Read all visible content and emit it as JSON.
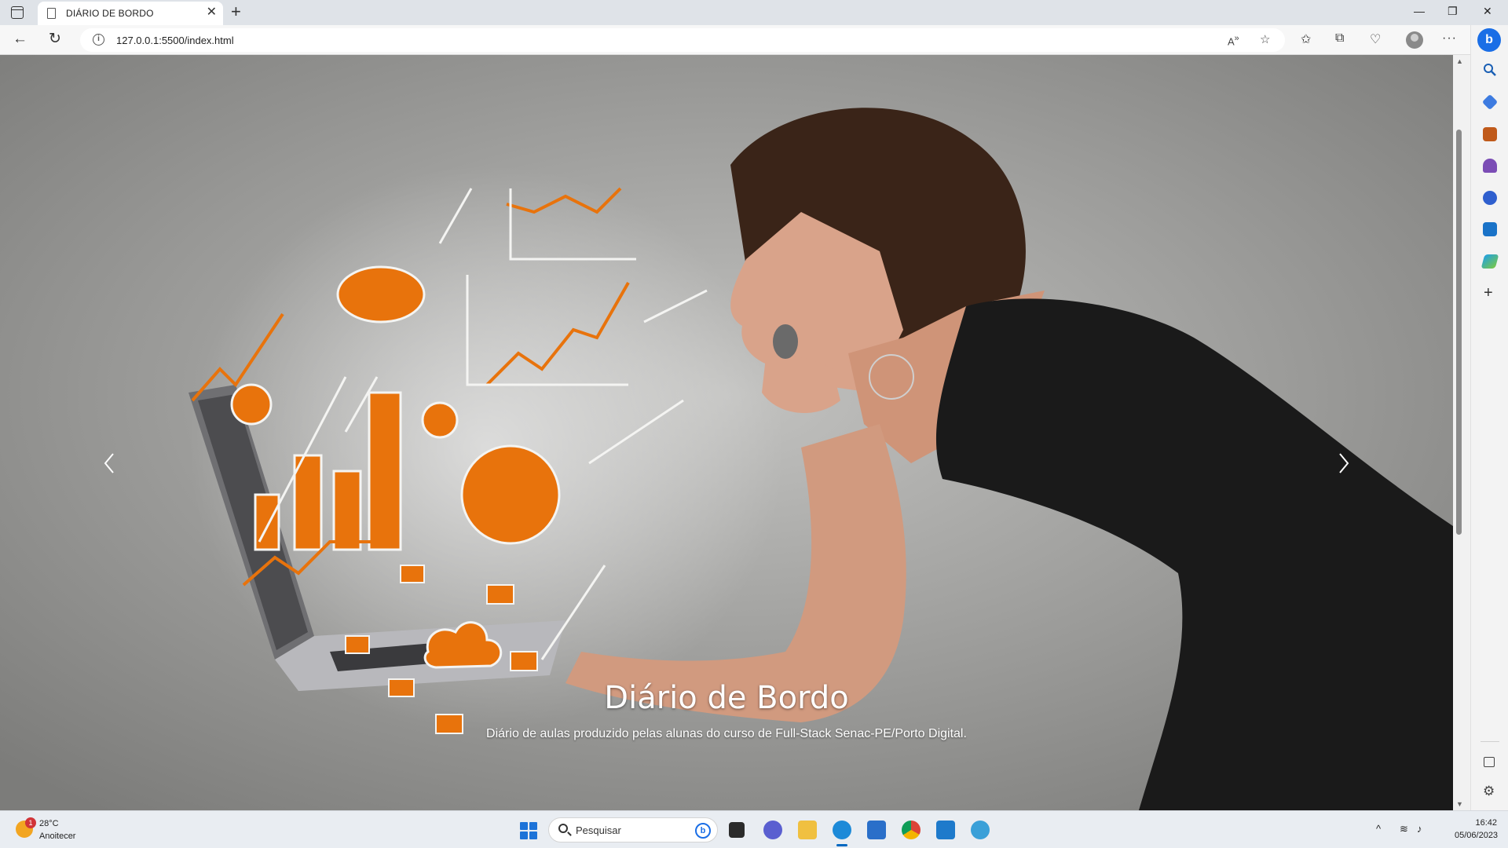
{
  "browser": {
    "tab_title": "DIÁRIO DE BORDO",
    "url": "127.0.0.1:5500/index.html"
  },
  "hero": {
    "title": "Diário de Bordo",
    "subtitle": "Diário de aulas produzido pelas alunas do curso de Full-Stack Senac-PE/Porto Digital."
  },
  "taskbar": {
    "weather_badge": "1",
    "weather_temp": "28°C",
    "weather_condition": "Anoitecer",
    "search_placeholder": "Pesquisar",
    "time": "16:42",
    "date": "05/06/2023"
  },
  "colors": {
    "accent": "#1a6ee6",
    "illustration_orange": "#e8730c"
  }
}
